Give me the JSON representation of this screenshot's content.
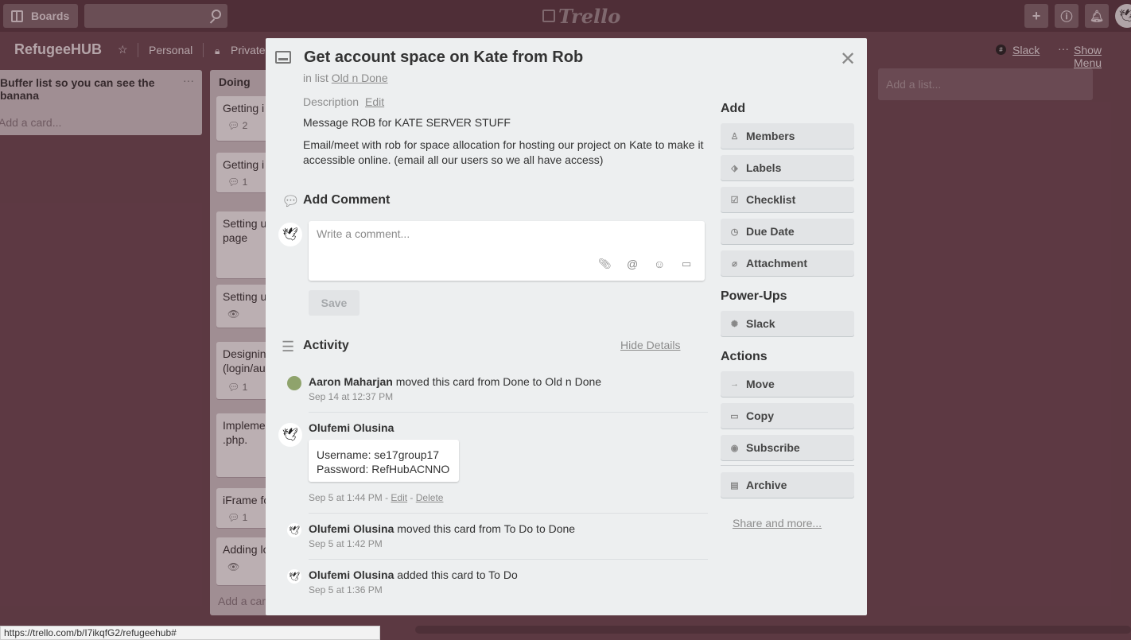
{
  "header": {
    "boards_label": "Boards",
    "logo_text": "Trello"
  },
  "board": {
    "title": "RefugeeHUB",
    "team": "Personal",
    "visibility": "Private",
    "slack_label": "Slack",
    "show_menu": "Show Menu"
  },
  "lists": [
    {
      "title": "Buffer list so you can see the banana",
      "add_card": "Add a card..."
    },
    {
      "title": "Doing",
      "add_card": "Add a card...",
      "cards": [
        {
          "text": "Getting i",
          "badge": "2"
        },
        {
          "text": "Getting i",
          "badge": "1"
        },
        {
          "text": "Setting u\npage"
        },
        {
          "text": "Setting u"
        },
        {
          "text": "Designin\n(login/au",
          "badge": "1"
        },
        {
          "text": "Impleme\n.php."
        },
        {
          "text": "iFrame fo",
          "badge": "1"
        },
        {
          "text": "Adding lo"
        }
      ]
    }
  ],
  "add_list": "Add a list...",
  "modal": {
    "title": "Get account space on Kate from Rob",
    "in_list_prefix": "in list",
    "list_name": "Old n Done",
    "description_label": "Description",
    "description_edit": "Edit",
    "description_line1": "Message ROB for KATE SERVER STUFF",
    "description_line2": "Email/meet with rob for space allocation for hosting our project on Kate to make it accessible online. (email all our users so we all have access)",
    "add_comment_title": "Add Comment",
    "comment_placeholder": "Write a comment...",
    "save_label": "Save",
    "activity_title": "Activity",
    "hide_details": "Hide Details",
    "activity": [
      {
        "author": "Aaron Maharjan",
        "action": "moved this card from Done to Old n Done",
        "date": "Sep 14 at 12:37 PM"
      },
      {
        "author": "Olufemi Olusina",
        "comment_line1": "Username: se17group17",
        "comment_line2": "Password: RefHubACNNO",
        "date": "Sep 5 at 1:44 PM",
        "edit": "Edit",
        "delete": "Delete"
      },
      {
        "author": "Olufemi Olusina",
        "action": "moved this card from To Do to Done",
        "date": "Sep 5 at 1:42 PM"
      },
      {
        "author": "Olufemi Olusina",
        "action": "added this card to To Do",
        "date": "Sep 5 at 1:36 PM"
      }
    ]
  },
  "sidebar": {
    "add_title": "Add",
    "add_buttons": [
      "Members",
      "Labels",
      "Checklist",
      "Due Date",
      "Attachment"
    ],
    "powerups_title": "Power-Ups",
    "powerups_buttons": [
      "Slack"
    ],
    "actions_title": "Actions",
    "actions_buttons": [
      "Move",
      "Copy",
      "Subscribe"
    ],
    "archive": "Archive",
    "share_more": "Share and more..."
  },
  "status_url": "https://trello.com/b/I7ikqfG2/refugeehub#"
}
